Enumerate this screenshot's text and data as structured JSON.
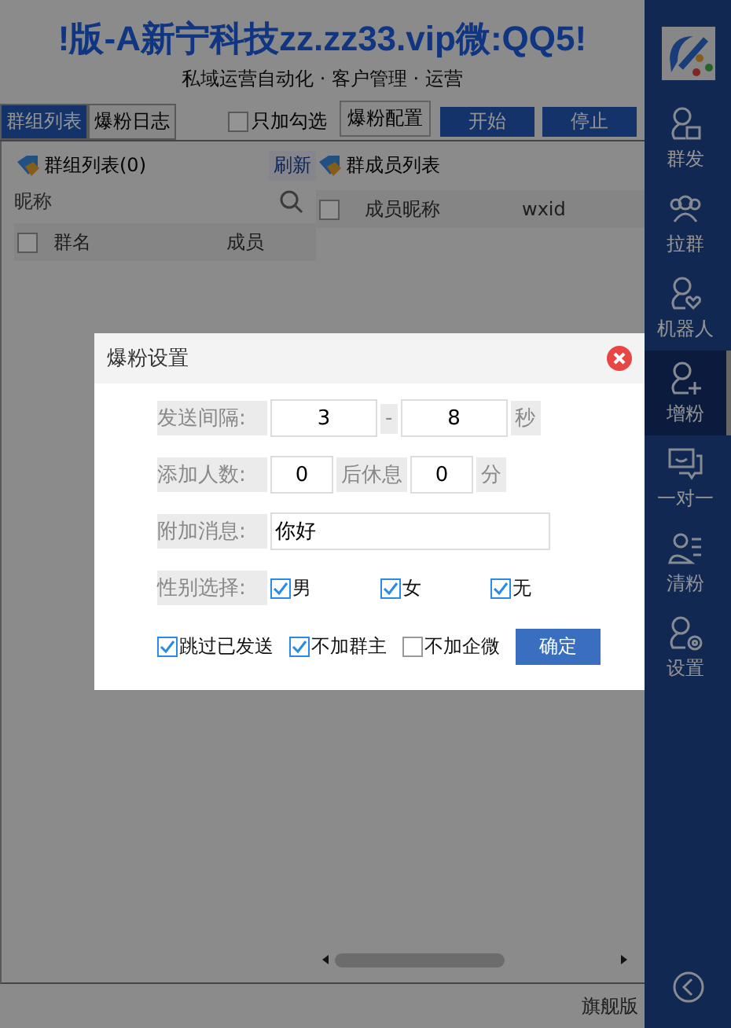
{
  "header": {
    "title": "!版-A新宁科技zz.zz33.vip微:QQ5!",
    "subtitle": "私域运营自动化 · 客户管理 · 运营"
  },
  "tabs": [
    {
      "label": "群组列表",
      "selected": true
    },
    {
      "label": "爆粉日志",
      "selected": false
    }
  ],
  "toolbar": {
    "only_checked": {
      "label": "只加勾选",
      "checked": false
    },
    "config_button": "爆粉配置",
    "start_button": "开始",
    "stop_button": "停止"
  },
  "group_panel": {
    "title": "群组列表(0)",
    "refresh": "刷新",
    "search_placeholder": "昵称",
    "select_all": false,
    "columns": [
      "群名",
      "成员"
    ]
  },
  "member_panel": {
    "title": "群成员列表",
    "select_all": false,
    "columns": [
      "成员昵称",
      "wxid"
    ]
  },
  "status_bar": "旗舰版",
  "sidebar": {
    "items": [
      {
        "kind": "mass-send",
        "label": "群发",
        "selected": false
      },
      {
        "kind": "pull-group",
        "label": "拉群",
        "selected": false
      },
      {
        "kind": "robot",
        "label": "机器人",
        "selected": false
      },
      {
        "kind": "add-fans",
        "label": "增粉",
        "selected": true
      },
      {
        "kind": "chat",
        "label": "一对一",
        "selected": false
      },
      {
        "kind": "clear",
        "label": "清粉",
        "selected": false
      },
      {
        "kind": "settings",
        "label": "设置",
        "selected": false
      }
    ]
  },
  "dialog": {
    "title": "爆粉设置",
    "interval": {
      "label": "发送间隔:",
      "from": "3",
      "separator": "-",
      "to": "8",
      "unit": "秒"
    },
    "batch": {
      "label": "添加人数:",
      "count": "0",
      "middle": "后休息",
      "rest": "0",
      "unit": "分"
    },
    "message": {
      "label": "附加消息:",
      "value": "你好"
    },
    "gender": {
      "label": "性别选择:",
      "options": [
        {
          "label": "男",
          "checked": true
        },
        {
          "label": "女",
          "checked": true
        },
        {
          "label": "无",
          "checked": true
        }
      ]
    },
    "options": [
      {
        "label": "跳过已发送",
        "checked": true
      },
      {
        "label": "不加群主",
        "checked": true
      },
      {
        "label": "不加企微",
        "checked": false
      }
    ],
    "confirm": "确定"
  }
}
